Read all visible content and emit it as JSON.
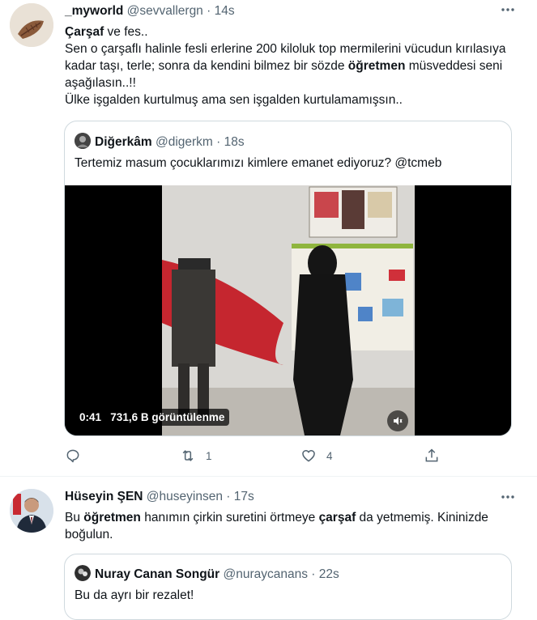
{
  "tweet1": {
    "display_name": "_myworld",
    "handle": "@sevvallergn",
    "separator": "·",
    "time": "14s",
    "more_icon": "more-horizontal-icon",
    "text_line1_bold": "Çarşaf",
    "text_line1_rest": " ve fes..",
    "text_line2": "Sen o çarşaflı halinle fesli erlerine 200 kiloluk top mermilerini vücudun kırılasıya kadar taşı, terle; sonra da kendini bilmez bir sözde ",
    "text_line2_bold": "öğretmen",
    "text_line3": " müsveddesi seni aşağılasın..!!",
    "text_line4": "Ülke işgalden kurtulmuş ama sen işgalden kurtulamamışsın..",
    "quote": {
      "display_name": "Diğerkâm",
      "handle": "@digerkm",
      "separator": "·",
      "time": "18s",
      "text": "Tertemiz masum çocuklarımızı kimlere emanet ediyoruz?  @tcmeb",
      "video": {
        "duration": "0:41",
        "views": "731,6 B görüntülenme",
        "volume_icon": "volume-icon"
      }
    },
    "actions": {
      "reply_count": "",
      "retweet_count": "1",
      "like_count": "4"
    }
  },
  "tweet2": {
    "display_name": "Hüseyin ŞEN",
    "handle": "@huseyinsen",
    "separator": "·",
    "time": "17s",
    "text_a": "Bu ",
    "text_b_bold": "öğretmen",
    "text_c": " hanımın çirkin suretini örtmeye ",
    "text_d_bold": "çarşaf",
    "text_e": " da yetmemiş. Kininizde boğulun.",
    "quote": {
      "display_name": "Nuray Canan Songür",
      "handle": "@nuraycanans",
      "separator": "·",
      "time": "22s",
      "text": "Bu da ayrı bir rezalet!"
    }
  },
  "colors": {
    "text": "#0f1419",
    "muted": "#536471",
    "border": "#cfd9de",
    "divider": "#eff3f4"
  }
}
